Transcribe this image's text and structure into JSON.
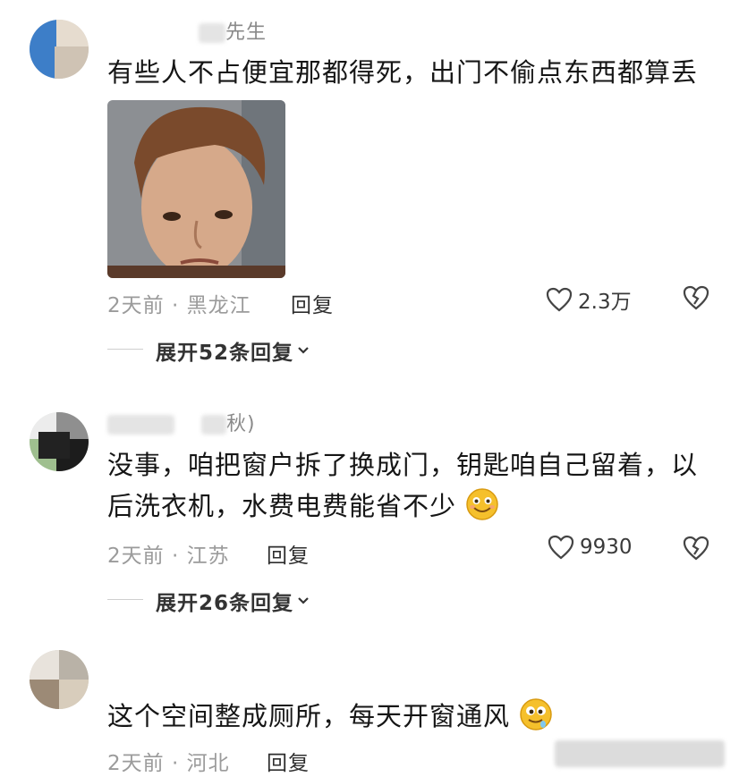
{
  "comments": [
    {
      "username": "先生",
      "text": "有些人不占便宜那都得死，出门不偷点东西都算丢",
      "time": "2天前",
      "location": "黑龙江",
      "reply_label": "回复",
      "likes": "2.3万",
      "expand_label": "展开52条回复",
      "has_image": true
    },
    {
      "username": "秋)",
      "text_line1": "没事，咱把窗户拆了换成门，钥匙咱自己留着，以",
      "text_line2": "后洗衣机，水费电费能省不少",
      "emoji": "smile-emoji",
      "time": "2天前",
      "location": "江苏",
      "reply_label": "回复",
      "likes": "9930",
      "expand_label": "展开26条回复"
    },
    {
      "username": "",
      "text": "这个空间整成厕所，每天开窗通风",
      "emoji": "drool-emoji",
      "time": "2天前",
      "location": "河北",
      "reply_label": "回复"
    }
  ],
  "icons": {
    "like": "heart-outline-icon",
    "dislike": "broken-heart-icon",
    "chevron": "chevron-down-icon"
  },
  "colors": {
    "meta": "#9b9b9b",
    "text": "#161616",
    "emoji": "#f5c02c"
  }
}
